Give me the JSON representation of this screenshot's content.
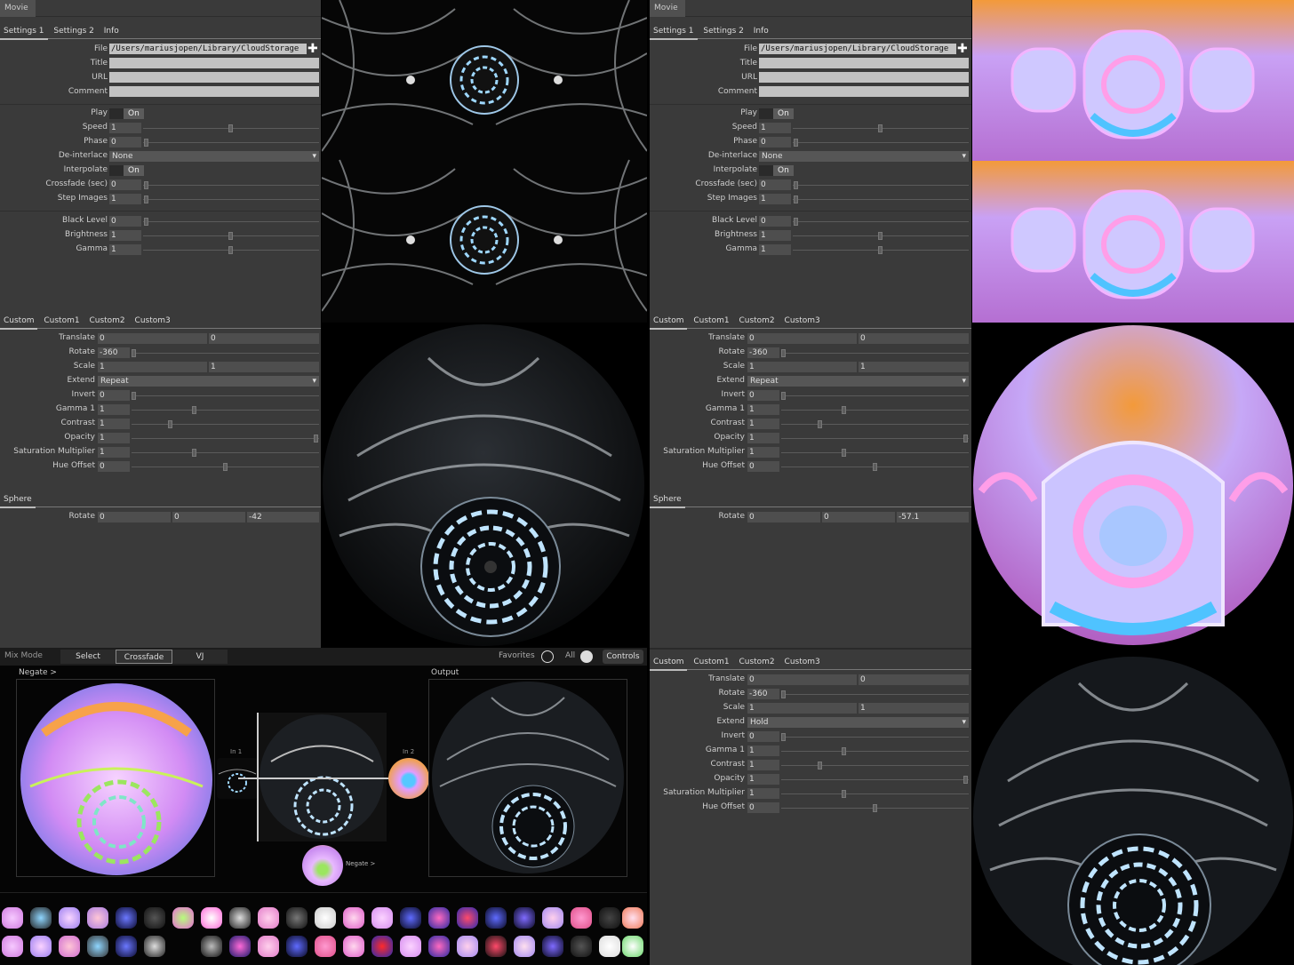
{
  "left_panel": {
    "title": "Movie",
    "tabs": [
      "Settings 1",
      "Settings 2",
      "Info"
    ],
    "file_label": "File",
    "file_value": "/Users/mariusjopen/Library/CloudStorage",
    "title_label": "Title",
    "url_label": "URL",
    "comment_label": "Comment",
    "play_label": "Play",
    "play_value": "On",
    "speed_label": "Speed",
    "speed_value": "1",
    "phase_label": "Phase",
    "phase_value": "0",
    "deinterlace_label": "De-interlace",
    "deinterlace_value": "None",
    "interpolate_label": "Interpolate",
    "interpolate_value": "On",
    "crossfade_label": "Crossfade (sec)",
    "crossfade_value": "0",
    "step_label": "Step Images",
    "step_value": "1",
    "black_label": "Black Level",
    "black_value": "0",
    "brightness_label": "Brightness",
    "brightness_value": "1",
    "gamma_label": "Gamma",
    "gamma_value": "1",
    "custom_tabs": [
      "Custom",
      "Custom1",
      "Custom2",
      "Custom3"
    ],
    "translate_label": "Translate",
    "translate_x": "0",
    "translate_y": "0",
    "rotate_label": "Rotate",
    "rotate_value": "-360",
    "scale_label": "Scale",
    "scale_x": "1",
    "scale_y": "1",
    "extend_label": "Extend",
    "extend_value": "Repeat",
    "invert_label": "Invert",
    "invert_value": "0",
    "gamma1_label": "Gamma 1",
    "gamma1_value": "1",
    "contrast_label": "Contrast",
    "contrast_value": "1",
    "opacity_label": "Opacity",
    "opacity_value": "1",
    "sat_label": "Saturation Multiplier",
    "sat_value": "1",
    "hue_label": "Hue Offset",
    "hue_value": "0",
    "sphere_tab": "Sphere",
    "sphere_rotate_label": "Rotate",
    "sphere_rotate": [
      "0",
      "0",
      "-42"
    ]
  },
  "right_panel": {
    "title": "Movie",
    "tabs": [
      "Settings 1",
      "Settings 2",
      "Info"
    ],
    "file_label": "File",
    "file_value": "/Users/mariusjopen/Library/CloudStorage",
    "title_label": "Title",
    "url_label": "URL",
    "comment_label": "Comment",
    "play_label": "Play",
    "play_value": "On",
    "speed_label": "Speed",
    "speed_value": "1",
    "phase_label": "Phase",
    "phase_value": "0",
    "deinterlace_label": "De-interlace",
    "deinterlace_value": "None",
    "interpolate_label": "Interpolate",
    "interpolate_value": "On",
    "crossfade_label": "Crossfade (sec)",
    "crossfade_value": "0",
    "step_label": "Step Images",
    "step_value": "1",
    "black_label": "Black Level",
    "black_value": "0",
    "brightness_label": "Brightness",
    "brightness_value": "1",
    "gamma_label": "Gamma",
    "gamma_value": "1",
    "custom_tabs": [
      "Custom",
      "Custom1",
      "Custom2",
      "Custom3"
    ],
    "translate_label": "Translate",
    "translate_x": "0",
    "translate_y": "0",
    "rotate_label": "Rotate",
    "rotate_value": "-360",
    "scale_label": "Scale",
    "scale_x": "1",
    "scale_y": "1",
    "extend_label": "Extend",
    "extend_value": "Repeat",
    "invert_label": "Invert",
    "invert_value": "0",
    "gamma1_label": "Gamma 1",
    "gamma1_value": "1",
    "contrast_label": "Contrast",
    "contrast_value": "1",
    "opacity_label": "Opacity",
    "opacity_value": "1",
    "sat_label": "Saturation Multiplier",
    "sat_value": "1",
    "hue_label": "Hue Offset",
    "hue_value": "0",
    "sphere_tab": "Sphere",
    "sphere_rotate_label": "Rotate",
    "sphere_rotate": [
      "0",
      "0",
      "-57.1"
    ]
  },
  "right_custom2": {
    "custom_tabs": [
      "Custom",
      "Custom1",
      "Custom2",
      "Custom3"
    ],
    "translate_label": "Translate",
    "translate_x": "0",
    "translate_y": "0",
    "rotate_label": "Rotate",
    "rotate_value": "-360",
    "scale_label": "Scale",
    "scale_x": "1",
    "scale_y": "1",
    "extend_label": "Extend",
    "extend_value": "Hold",
    "invert_label": "Invert",
    "invert_value": "0",
    "gamma1_label": "Gamma 1",
    "gamma1_value": "1",
    "contrast_label": "Contrast",
    "contrast_value": "1",
    "opacity_label": "Opacity",
    "opacity_value": "1",
    "sat_label": "Saturation Multiplier",
    "sat_value": "1",
    "hue_label": "Hue Offset",
    "hue_value": "0"
  },
  "mixer": {
    "mix_mode_label": "Mix Mode",
    "select_label": "Select",
    "crossfade_label": "Crossfade",
    "vj_label": "VJ",
    "favorites_label": "Favorites",
    "all_label": "All",
    "controls_label": "Controls",
    "negate_top": "Negate  >",
    "output_label": "Output",
    "in1_label": "In 1",
    "in2_label": "In 2",
    "negate_bottom": "Negate  >"
  },
  "colors": {
    "panel_bg": "#3a3a3a",
    "field_bg": "#c2c2c2",
    "accent_orange": "#f39a3a",
    "accent_violet": "#a89cf5",
    "accent_cyan": "#8fd6ff"
  }
}
